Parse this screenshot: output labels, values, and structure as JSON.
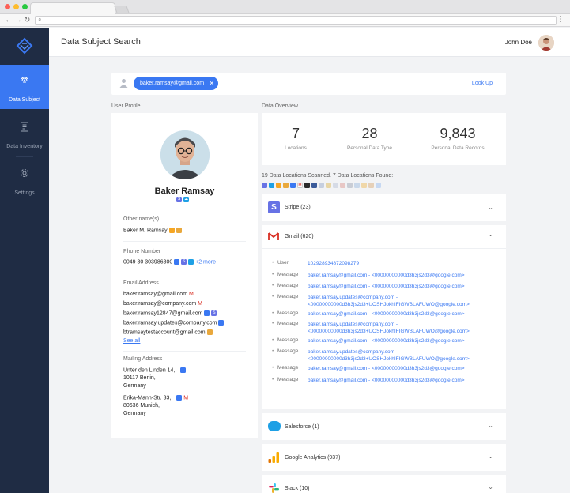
{
  "browser": {
    "url": ""
  },
  "colors": {
    "accent": "#3a78f2",
    "sidebar": "#1f2c44",
    "active_nav": "#3a78f2"
  },
  "sidebar": {
    "items": [
      {
        "label": "Data Subject",
        "icon": "fingerprint-icon",
        "active": true
      },
      {
        "label": "Data Inventory",
        "icon": "clipboard-icon",
        "active": false
      },
      {
        "label": "Settings",
        "icon": "gear-icon",
        "active": false
      }
    ]
  },
  "header": {
    "title": "Data Subject Search",
    "user_name": "John Doe"
  },
  "search": {
    "chip_value": "baker.ramsay@gmail.com",
    "action": "Look Up"
  },
  "profile": {
    "section_label": "User Profile",
    "name": "Baker Ramsay",
    "other_names_label": "Other name(s)",
    "other_names": "Baker M. Ramsay",
    "phone_label": "Phone Number",
    "phone": "0049 30 303986300",
    "phone_more": "+2 more",
    "email_label": "Email Address",
    "emails": [
      "baker.ramsay@gmail.com",
      "baker.ramsay@company.com",
      "baker.ramsay12847@gmail.com",
      "baker.ramsay.updates@company.com",
      "btramsaytestaccount@gmail.com"
    ],
    "see_all": "See all",
    "mailing_label": "Mailing Address",
    "address1": [
      "Unter den Linden 14,",
      "10117 Berlin,",
      "Germany"
    ],
    "address2": [
      "Erika-Mann-Str. 33,",
      "80636 Munich,",
      "Germany"
    ]
  },
  "overview": {
    "section_label": "Data Overview",
    "stats": [
      {
        "value": "7",
        "label": "Locations"
      },
      {
        "value": "28",
        "label": "Personal Data Type"
      },
      {
        "value": "9,843",
        "label": "Personal Data Records"
      }
    ],
    "scan_text": "19 Data Locations Scanned. 7 Data Locations Found:"
  },
  "sources": [
    {
      "name": "Stripe (23)",
      "icon": "stripe-icon"
    },
    {
      "name": "Gmail (620)",
      "icon": "gmail-icon"
    },
    {
      "name": "Salesforce (1)",
      "icon": "salesforce-icon"
    },
    {
      "name": "Google Analytics (937)",
      "icon": "analytics-icon"
    },
    {
      "name": "Slack (10)",
      "icon": "slack-icon"
    }
  ],
  "gmail_records": [
    {
      "key": "User",
      "value": "102928934872098279"
    },
    {
      "key": "Message",
      "value": "baker.ramsay@gmail.com - <00000000000d3h3js2d3@google.com>"
    },
    {
      "key": "Message",
      "value": "baker.ramsay@gmail.com - <00000000000d3h3js2d3@google.com>"
    },
    {
      "key": "Message",
      "value": "baker.ramsay.updates@company.com - <00000000000d3h3js2d3+UOSHJokhIFIGWBLAFUWO@google.com>"
    },
    {
      "key": "Message",
      "value": "baker.ramsay@gmail.com - <00000000000d3h3js2d3@google.com>"
    },
    {
      "key": "Message",
      "value": "baker.ramsay.updates@company.com - <00000000000d3h3js2d3+UOSHJokhIFIGWBLAFUWO@google.com>"
    },
    {
      "key": "Message",
      "value": "baker.ramsay@gmail.com - <00000000000d3h3js2d3@google.com>"
    },
    {
      "key": "Message",
      "value": "baker.ramsay.updates@company.com - <00000000000d3h3js2d3+UOSHJokhIFIGWBLAFUWO@google.com>"
    },
    {
      "key": "Message",
      "value": "baker.ramsay@gmail.com - <00000000000d3h3js2d3@google.com>"
    },
    {
      "key": "Message",
      "value": "baker.ramsay@gmail.com - <00000000000d3h3js2d3@google.com>"
    }
  ]
}
